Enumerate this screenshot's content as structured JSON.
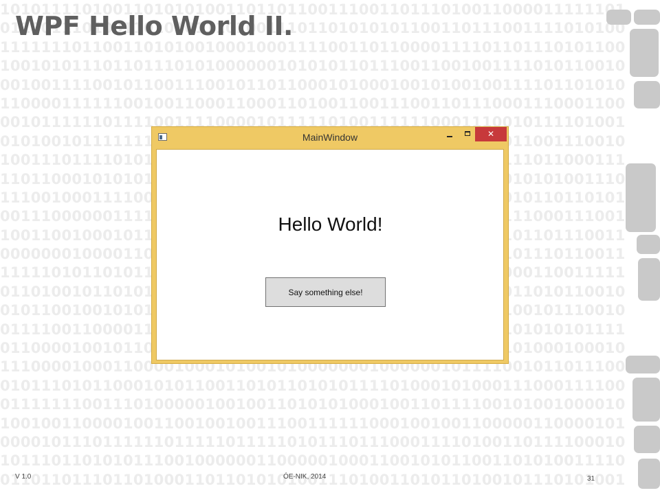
{
  "slide": {
    "title": "WPF Hello World II.",
    "footer_version": "V 1.0",
    "footer_org": "ÓE-NIK, 2014",
    "page_number": "31"
  },
  "window": {
    "title": "MainWindow",
    "close_glyph": "✕",
    "hello_text": "Hello World!",
    "button_label": "Say something else!",
    "icons": [
      "app-icon",
      "minimize-icon",
      "maximize-icon",
      "close-icon"
    ]
  },
  "colors": {
    "window_frame": "#efc964",
    "close_button": "#c7393b",
    "title_text": "#5f5f5f",
    "background_digits": "#ececec",
    "decorative_tiles": "#c9c9c9"
  }
}
